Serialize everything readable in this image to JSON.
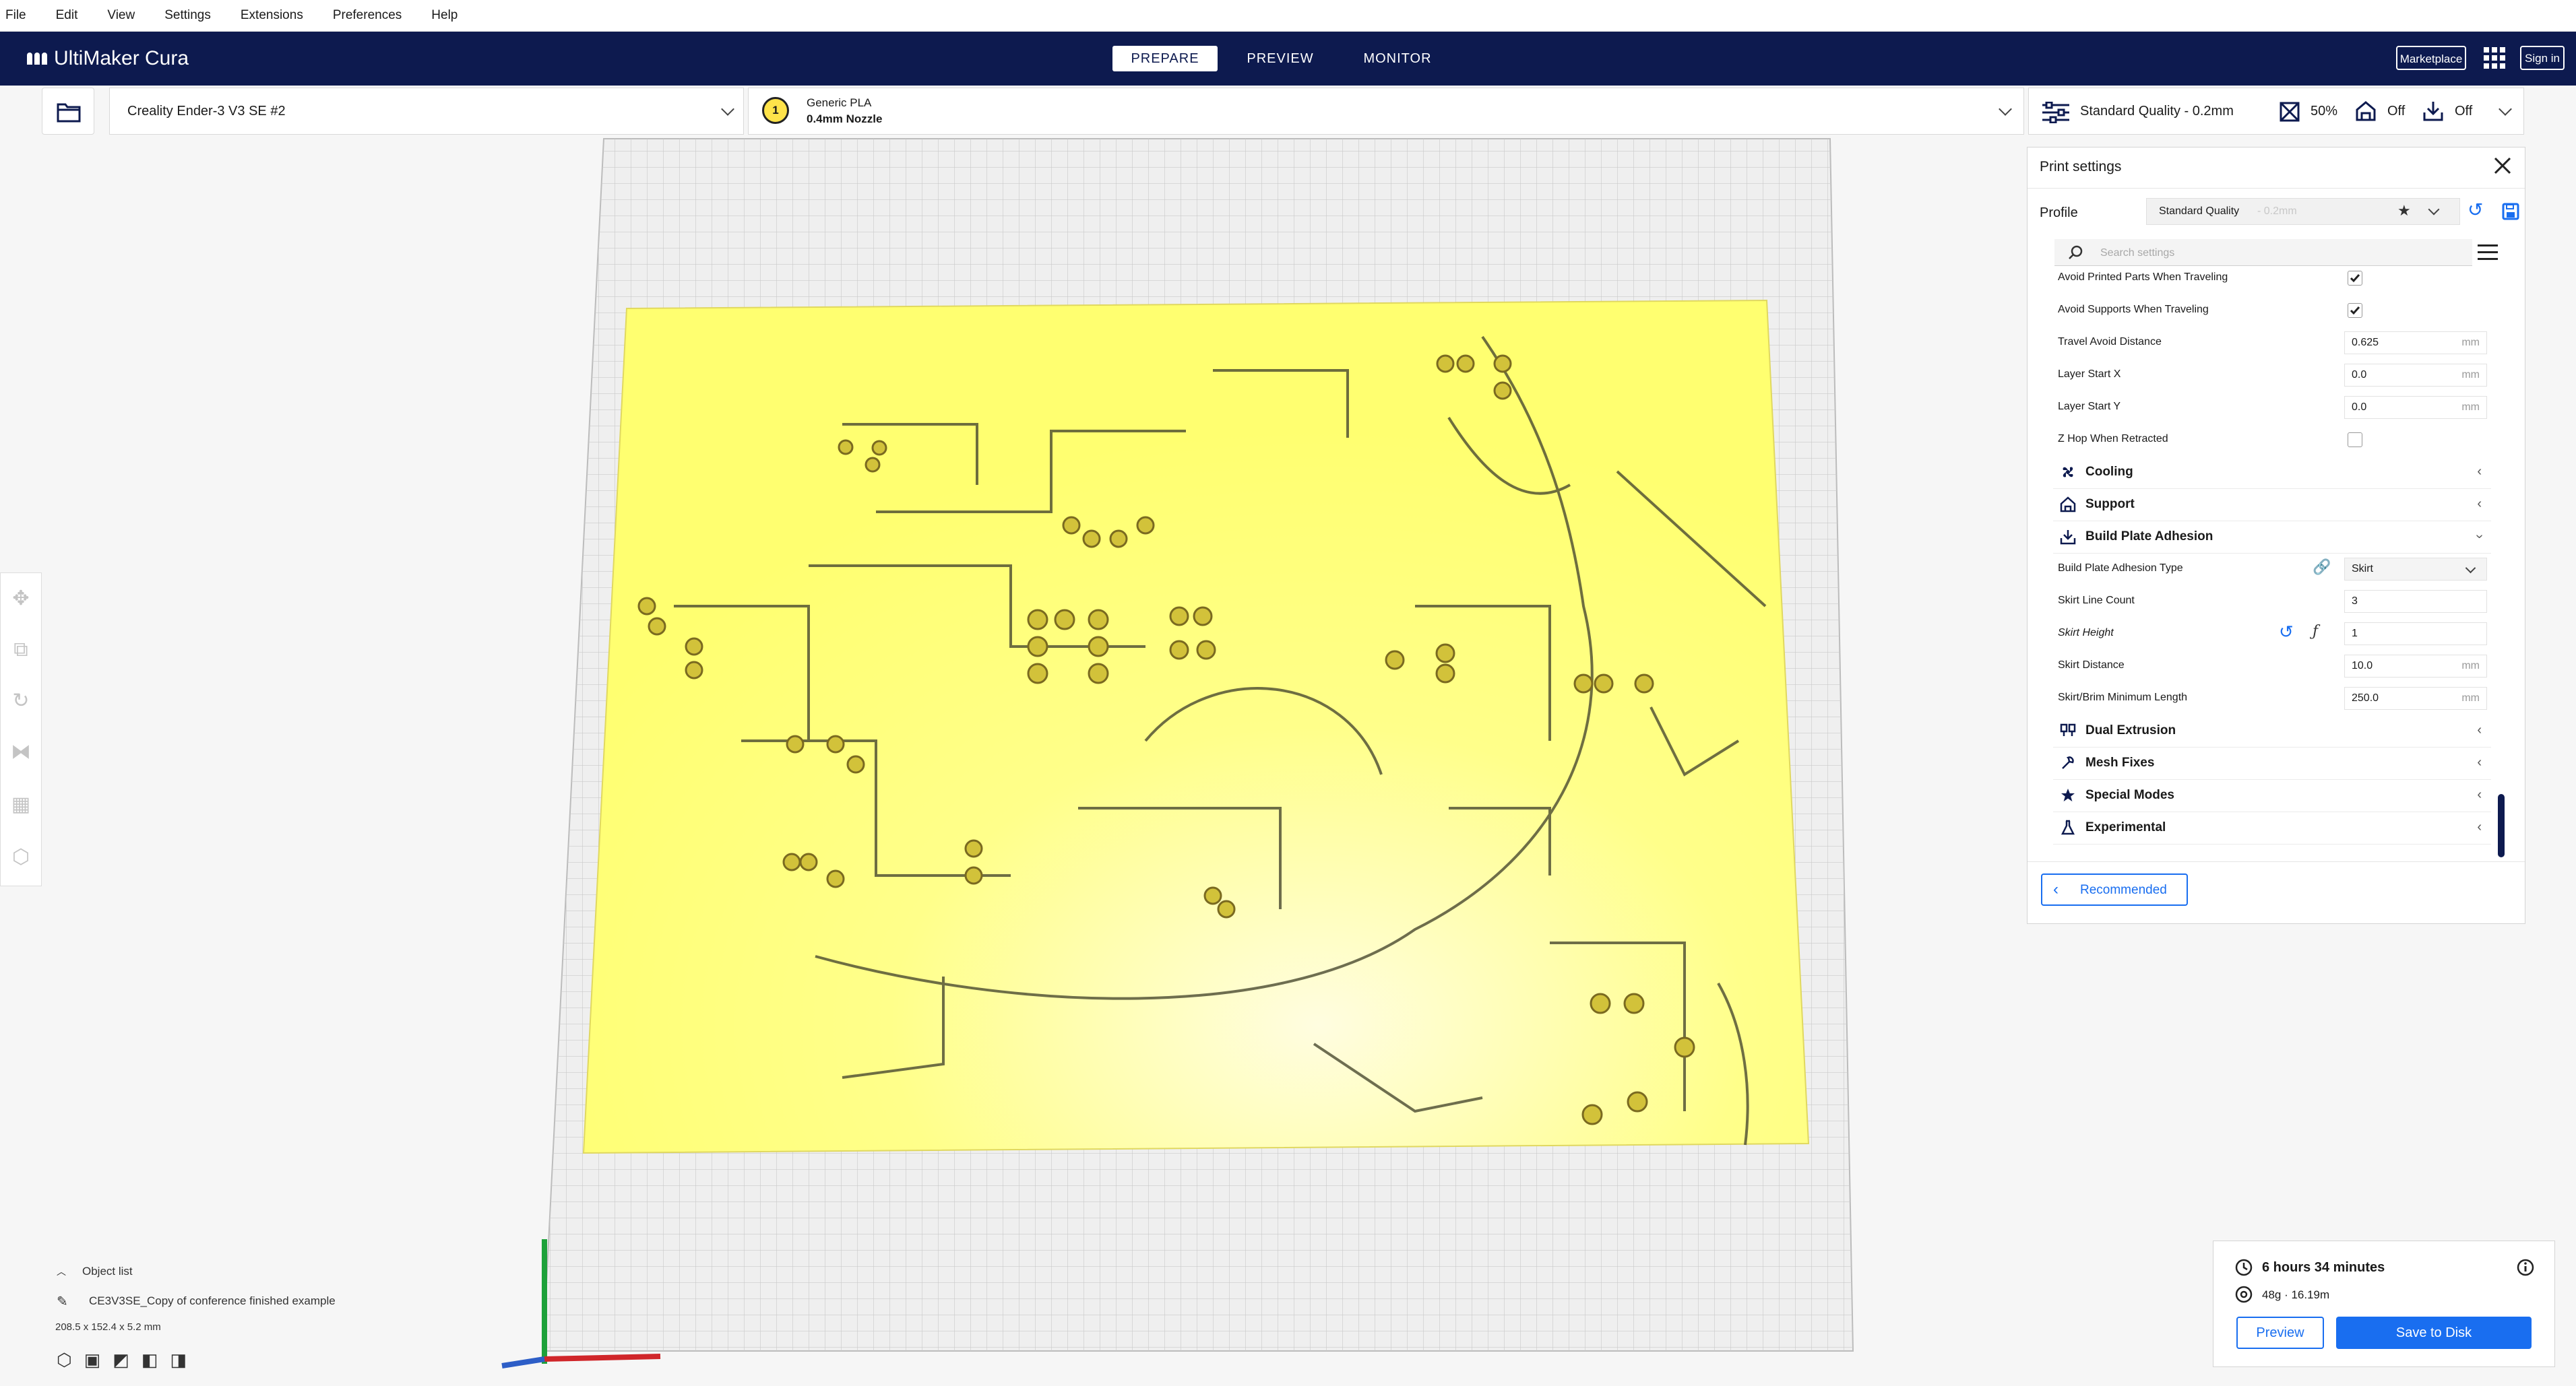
{
  "menu": [
    "File",
    "Edit",
    "View",
    "Settings",
    "Extensions",
    "Preferences",
    "Help"
  ],
  "header": {
    "logo": "UltiMaker Cura",
    "tabs": [
      "PREPARE",
      "PREVIEW",
      "MONITOR"
    ],
    "active_tab": "PREPARE",
    "marketplace": "Marketplace",
    "sign_in": "Sign in"
  },
  "toolbar": {
    "printer": "Creality Ender-3 V3 SE #2",
    "extruder_number": "1",
    "material": "Generic PLA",
    "nozzle": "0.4mm Nozzle",
    "quality": "Standard Quality - 0.2mm",
    "infill": "50%",
    "support": "Off",
    "adhesion": "Off"
  },
  "print_settings": {
    "title": "Print settings",
    "profile_label": "Profile",
    "profile_value": "Standard Quality",
    "profile_suffix": "- 0.2mm",
    "search_placeholder": "Search settings",
    "travel_rows": [
      {
        "label": "Avoid Printed Parts When Traveling",
        "type": "checkbox",
        "checked": true
      },
      {
        "label": "Avoid Supports When Traveling",
        "type": "checkbox",
        "checked": true
      },
      {
        "label": "Travel Avoid Distance",
        "type": "value",
        "value": "0.625",
        "unit": "mm"
      },
      {
        "label": "Layer Start X",
        "type": "value",
        "value": "0.0",
        "unit": "mm"
      },
      {
        "label": "Layer Start Y",
        "type": "value",
        "value": "0.0",
        "unit": "mm"
      },
      {
        "label": "Z Hop When Retracted",
        "type": "checkbox",
        "checked": false
      }
    ],
    "categories_top": [
      {
        "label": "Cooling",
        "icon": "fan-icon"
      },
      {
        "label": "Support",
        "icon": "support-icon"
      }
    ],
    "adhesion_category": "Build Plate Adhesion",
    "adhesion_rows": [
      {
        "label": "Build Plate Adhesion Type",
        "type": "select",
        "value": "Skirt"
      },
      {
        "label": "Skirt Line Count",
        "type": "value",
        "value": "3",
        "unit": ""
      },
      {
        "label": "Skirt Height",
        "type": "value",
        "value": "1",
        "unit": "",
        "italic": true
      },
      {
        "label": "Skirt Distance",
        "type": "value",
        "value": "10.0",
        "unit": "mm"
      },
      {
        "label": "Skirt/Brim Minimum Length",
        "type": "value",
        "value": "250.0",
        "unit": "mm"
      }
    ],
    "categories_bottom": [
      {
        "label": "Dual Extrusion",
        "icon": "dual-extrusion-icon"
      },
      {
        "label": "Mesh Fixes",
        "icon": "mesh-fixes-icon"
      },
      {
        "label": "Special Modes",
        "icon": "special-modes-icon"
      },
      {
        "label": "Experimental",
        "icon": "flask-icon"
      }
    ],
    "recommended": "Recommended"
  },
  "object_list": {
    "title": "Object list",
    "object_name": "CE3V3SE_Copy of conference finished example",
    "dimensions": "208.5 x 152.4 x 5.2 mm"
  },
  "action_panel": {
    "time": "6 hours 34 minutes",
    "material_usage": "48g · 16.19m",
    "preview": "Preview",
    "save": "Save to Disk"
  },
  "colors": {
    "header_bg": "#0d1a4f",
    "accent": "#196ef0",
    "model": "#ffff6e"
  }
}
